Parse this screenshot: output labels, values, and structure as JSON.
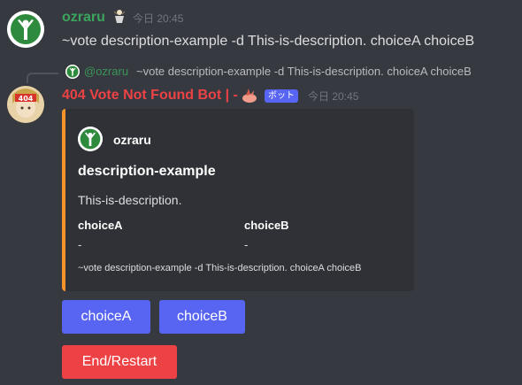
{
  "messages": {
    "user": {
      "username": "ozraru",
      "timestamp": "今日 20:45",
      "text": "~vote description-example -d This-is-description. choiceA choiceB"
    },
    "bot": {
      "reply_name": "@ozraru",
      "reply_text": "~vote description-example -d This-is-description. choiceA choiceB",
      "username": "404 Vote Not Found Bot | -",
      "badge": "ボット",
      "timestamp": "今日 20:45"
    }
  },
  "embed": {
    "author": "ozraru",
    "title": "description-example",
    "description": "This-is-description.",
    "fields": [
      {
        "name": "choiceA",
        "value": "-"
      },
      {
        "name": "choiceB",
        "value": "-"
      }
    ],
    "footer": "~vote description-example -d This-is-description. choiceA choiceB",
    "accent_color": "#f5932b"
  },
  "buttons": {
    "choiceA": "choiceA",
    "choiceB": "choiceB",
    "end": "End/Restart"
  },
  "colors": {
    "background": "#36393f",
    "user_name": "#3ba55d",
    "bot_name": "#ed4245",
    "primary": "#5865f2",
    "danger": "#ed4245"
  }
}
